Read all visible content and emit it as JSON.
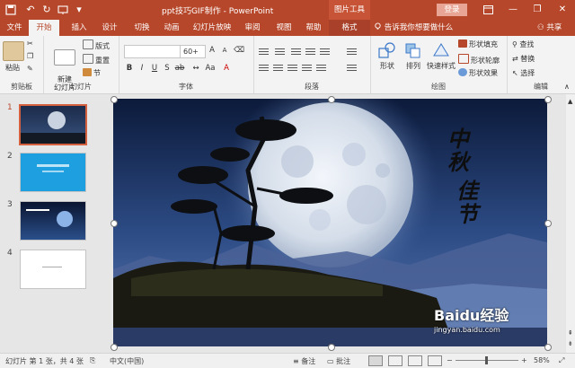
{
  "titlebar": {
    "title": "ppt技巧GIF制作 - PowerPoint",
    "context_tool": "图片工具",
    "login_label": "登录",
    "minimize": "—",
    "restore": "❐",
    "close": "✕",
    "accent": "#b7472a"
  },
  "tabs": {
    "file": "文件",
    "home": "开始",
    "insert": "插入",
    "design": "设计",
    "transitions": "切换",
    "animations": "动画",
    "slideshow": "幻灯片放映",
    "review": "审阅",
    "view": "视图",
    "help": "帮助",
    "format": "格式",
    "search": "告诉我你想要做什么",
    "share": "共享"
  },
  "ribbon": {
    "clipboard": {
      "paste": "粘贴",
      "label": "剪贴板"
    },
    "slides": {
      "new_slide": "新建\n幻灯片",
      "layout": "版式",
      "reset": "重置",
      "section": "节",
      "label": "幻灯片"
    },
    "font": {
      "font_name": "",
      "font_size": "60+",
      "label": "字体"
    },
    "paragraph": {
      "label": "段落"
    },
    "drawing": {
      "shapes": "形状",
      "arrange": "排列",
      "quick_styles": "快速样式",
      "fill": "形状填充",
      "outline": "形状轮廓",
      "effects": "形状效果",
      "label": "绘图"
    },
    "editing": {
      "find": "查找",
      "replace": "替换",
      "select": "选择",
      "label": "编辑"
    }
  },
  "slides": [
    {
      "number": "1",
      "active": true
    },
    {
      "number": "2",
      "active": false
    },
    {
      "number": "3",
      "active": false
    },
    {
      "number": "4",
      "active": false
    }
  ],
  "slide_text": {
    "line1": "中秋",
    "line2": "佳节"
  },
  "statusbar": {
    "slide_info": "幻灯片 第 1 张，共 4 张",
    "language": "中文(中国)",
    "notes": "备注",
    "comments": "批注",
    "zoom": "58%"
  },
  "watermark": {
    "brand": "Baidu经验",
    "url": "jingyan.baidu.com"
  }
}
